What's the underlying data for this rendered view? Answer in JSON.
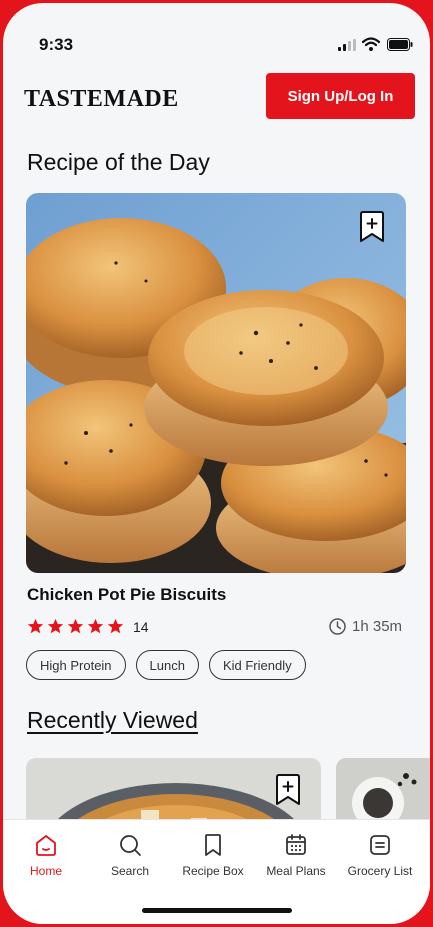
{
  "status_bar": {
    "time": "9:33"
  },
  "header": {
    "logo": "TASTEMADE",
    "signup_label": "Sign Up/Log In"
  },
  "recipe_of_day": {
    "section_title": "Recipe of the Day",
    "name": "Chicken Pot Pie Biscuits",
    "rating_stars": 5,
    "rating_count": "14",
    "duration": "1h 35m",
    "tags": [
      "High Protein",
      "Lunch",
      "Kid Friendly"
    ]
  },
  "recently_viewed": {
    "section_title": "Recently Viewed"
  },
  "tabs": [
    {
      "label": "Home",
      "icon": "home-icon",
      "active": true
    },
    {
      "label": "Search",
      "icon": "search-icon",
      "active": false
    },
    {
      "label": "Recipe Box",
      "icon": "bookmark-icon",
      "active": false
    },
    {
      "label": "Meal Plans",
      "icon": "calendar-icon",
      "active": false
    },
    {
      "label": "Grocery List",
      "icon": "list-icon",
      "active": false
    }
  ],
  "colors": {
    "accent": "#e3141b",
    "background": "#f5f6f8",
    "text": "#111111"
  }
}
